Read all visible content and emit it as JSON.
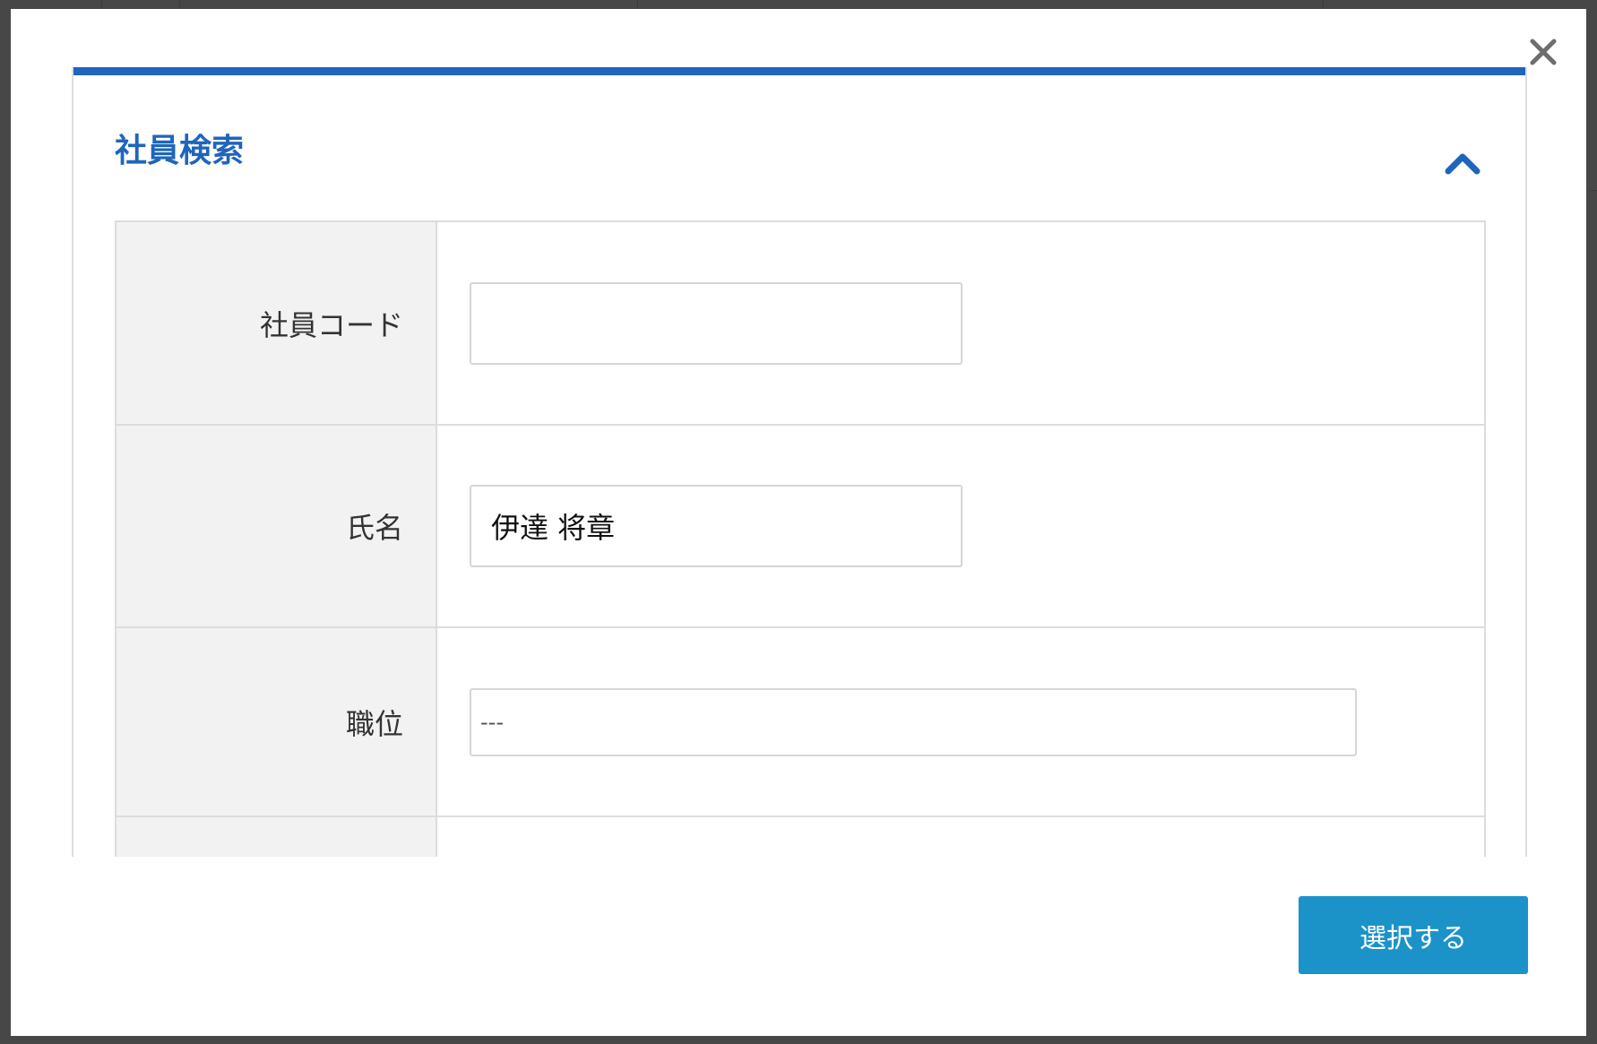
{
  "modal": {
    "close_icon": "close-icon",
    "panel": {
      "title": "社員検索",
      "collapse_icon": "chevron-up-icon",
      "accent_color": "#1f65bb"
    },
    "fields": {
      "employee_code": {
        "label": "社員コード",
        "value": ""
      },
      "name": {
        "label": "氏名",
        "value": "伊達 将章"
      },
      "position": {
        "label": "職位",
        "selected": "---"
      }
    },
    "footer": {
      "select_button_label": "選択する",
      "button_color": "#1b93c9"
    }
  }
}
